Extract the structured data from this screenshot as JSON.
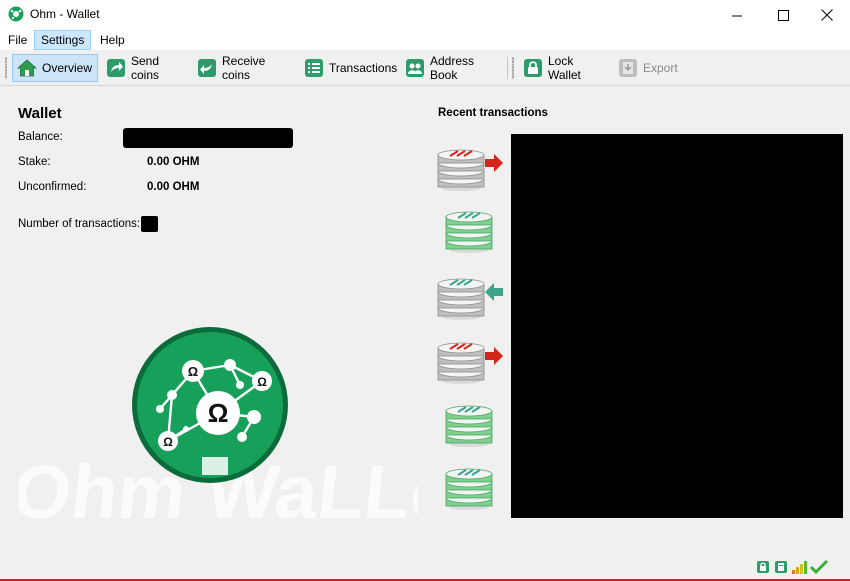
{
  "window": {
    "title": "Ohm - Wallet"
  },
  "menu": {
    "file": "File",
    "settings": "Settings",
    "help": "Help"
  },
  "toolbar": {
    "overview": "Overview",
    "send_coins": "Send coins",
    "receive_coins": "Receive coins",
    "transactions": "Transactions",
    "address_book": "Address Book",
    "lock_wallet": "Lock Wallet",
    "export": "Export"
  },
  "wallet": {
    "heading": "Wallet",
    "balance_label": "Balance:",
    "stake_label": "Stake:",
    "stake_value": "0.00 OHM",
    "unconfirmed_label": "Unconfirmed:",
    "unconfirmed_value": "0.00 OHM",
    "num_tx_label": "Number of transactions:"
  },
  "recent": {
    "heading": "Recent transactions",
    "items": [
      {
        "kind": "sent"
      },
      {
        "kind": "mined"
      },
      {
        "kind": "received"
      },
      {
        "kind": "sent"
      },
      {
        "kind": "mined"
      },
      {
        "kind": "mined"
      }
    ]
  },
  "colors": {
    "accent_green": "#1f9d55",
    "logo_green": "#16a05a",
    "logo_ring": "#0b6b3a",
    "sent_red": "#d4251b",
    "received_teal": "#3aa58a",
    "highlight": "#cce8ff"
  },
  "icons": {
    "app": "ohm-logo-icon",
    "overview": "home-icon",
    "send": "send-icon",
    "receive": "receive-icon",
    "transactions": "list-icon",
    "address_book": "contacts-icon",
    "lock": "lock-icon",
    "export": "export-icon"
  }
}
